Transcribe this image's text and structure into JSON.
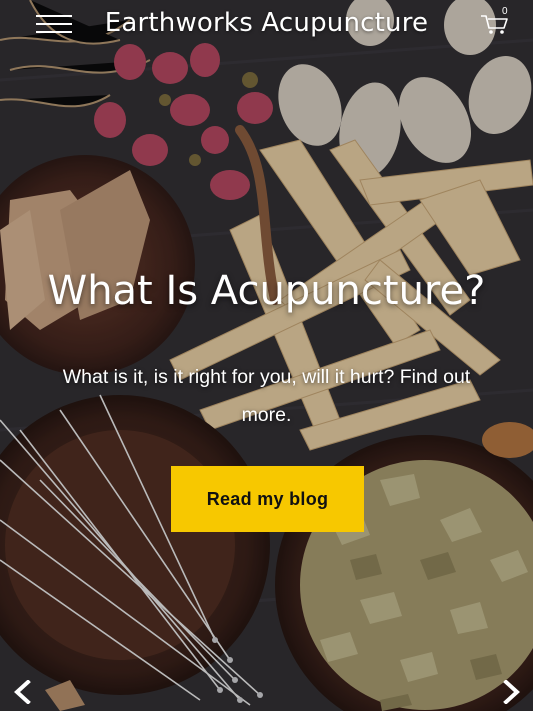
{
  "header": {
    "site_title": "Earthworks Acupuncture",
    "menu_icon": "hamburger-menu-icon",
    "cart_icon": "shopping-cart-icon",
    "cart_count": "0"
  },
  "hero": {
    "heading": "What Is Acupuncture?",
    "subtext": "What is it, is it right for you, will it hurt?  Find out more.",
    "cta_label": "Read my blog",
    "prev_icon": "chevron-left-icon",
    "next_icon": "chevron-right-icon"
  },
  "colors": {
    "accent": "#f7c800",
    "text": "#ffffff",
    "button_text": "#111111"
  }
}
